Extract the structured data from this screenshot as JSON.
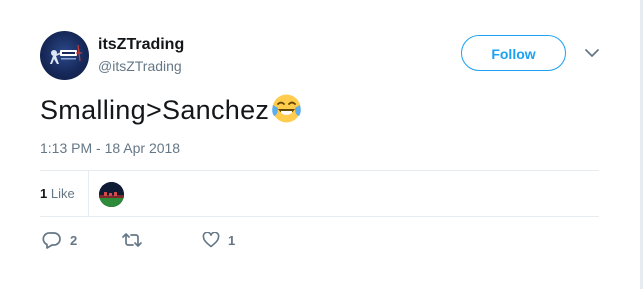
{
  "tweet": {
    "author": {
      "display_name": "itsZTrading",
      "handle": "@itsZTrading"
    },
    "follow_label": "Follow",
    "text": "Smalling>Sanchez",
    "emoji": "face-with-tears-of-joy",
    "timestamp": "1:13 PM - 18 Apr 2018",
    "stats": {
      "likes_count": "1",
      "likes_label": "Like"
    },
    "actions": {
      "reply_count": "2",
      "like_count": "1"
    }
  },
  "colors": {
    "accent": "#1da1f2",
    "text": "#14171a",
    "secondary": "#657786",
    "border": "#e6ecf0"
  }
}
